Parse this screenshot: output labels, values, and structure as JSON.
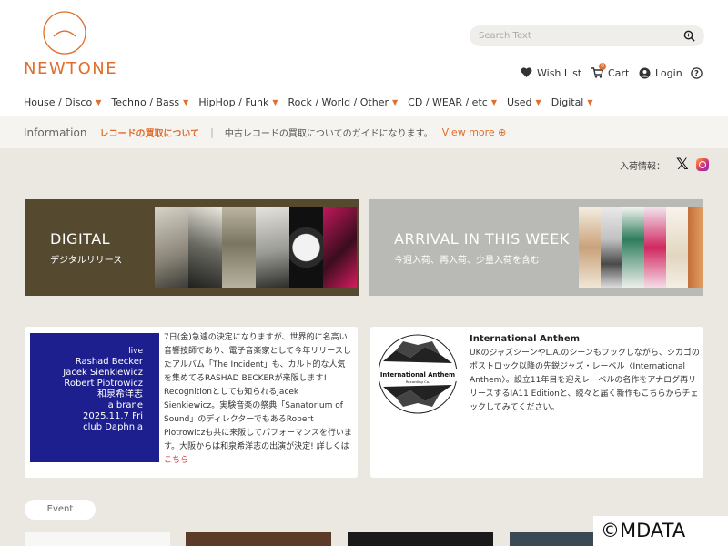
{
  "brand": {
    "logo_text": "NEWTONE",
    "accent_color": "#e06e2c"
  },
  "search": {
    "placeholder": "Search Text",
    "value": "",
    "icon": "search-icon"
  },
  "utility": {
    "wishlist_label": "Wish List",
    "cart_label": "Cart",
    "cart_count": "0",
    "login_label": "Login"
  },
  "nav": {
    "items": [
      {
        "label": "House / Disco"
      },
      {
        "label": "Techno / Bass"
      },
      {
        "label": "HipHop / Funk"
      },
      {
        "label": "Rock / World / Other"
      },
      {
        "label": "CD / WEAR / etc"
      },
      {
        "label": "Used"
      },
      {
        "label": "Digital"
      }
    ]
  },
  "info": {
    "label": "Information",
    "link": "レコードの買取について",
    "separator": "|",
    "description": "中古レコードの買取についてのガイドになります。",
    "more": "View more ⊕"
  },
  "social": {
    "label": "入荷情報："
  },
  "banners": {
    "digital": {
      "title": "DIGITAL",
      "subtitle": "デジタルリリース"
    },
    "arrival": {
      "title": "ARRIVAL IN THIS WEEK",
      "subtitle": "今週入荷、再入荷、少量入荷を含む"
    }
  },
  "card1": {
    "flyer": {
      "live": "live",
      "artist1": "Rashad Becker",
      "artist2": "Jacek Sienkiewicz",
      "artist3": "Robert Piotrowicz",
      "artist4": "和泉希洋志",
      "brane": "a brane",
      "date": "2025.11.7 Fri",
      "venue": "club Daphnia"
    },
    "text": "7日(金)急遽の決定になりますが、世界的に名高い音響技師であり、電子音楽家として今年リリースしたアルバム「The Incident」も、カルト的な人気を集めてるRASHAD BECKERが来阪します! Recognitionとしても知られるJacek Sienkiewicz。実験音楽の祭典「Sanatorium of Sound」のディレクターでもあるRobert Piotrowiczも共に来阪してパフォーマンスを行います。大阪からは和泉希洋志の出演が決定! 詳しくは",
    "link": "こちら"
  },
  "card2": {
    "logo_text": "International Anthem",
    "logo_sub": "Recording Co.",
    "title": "International Anthem",
    "text": "UKのジャズシーンやL.A.のシーンもフックしながら、シカゴのポストロック以降の先鋭ジャズ・レーベル〈International Anthem〉。設立11年目を迎えレーベルの名作をアナログ再リリースするIA11 Editionと、続々と届く新作もこちらからチェックしてみてください。"
  },
  "event": {
    "label": "Event"
  },
  "copyright": "©MDATA"
}
